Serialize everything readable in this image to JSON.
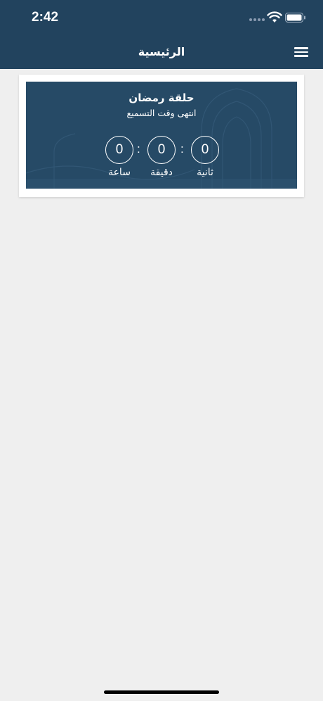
{
  "status_bar": {
    "time": "2:42"
  },
  "header": {
    "title": "الرئيسية"
  },
  "card": {
    "title": "حلقة رمضان",
    "subtitle": "انتهى وقت التسميع",
    "countdown": {
      "seconds": {
        "value": "0",
        "label": "ثانية"
      },
      "minutes": {
        "value": "0",
        "label": "دقيقة"
      },
      "hours": {
        "value": "0",
        "label": "ساعة"
      },
      "separator": ":"
    }
  },
  "colors": {
    "primary": "#22435e",
    "background": "#efefef"
  },
  "icons": [
    "menu-icon",
    "wifi-icon",
    "battery-icon",
    "signal-icon"
  ]
}
